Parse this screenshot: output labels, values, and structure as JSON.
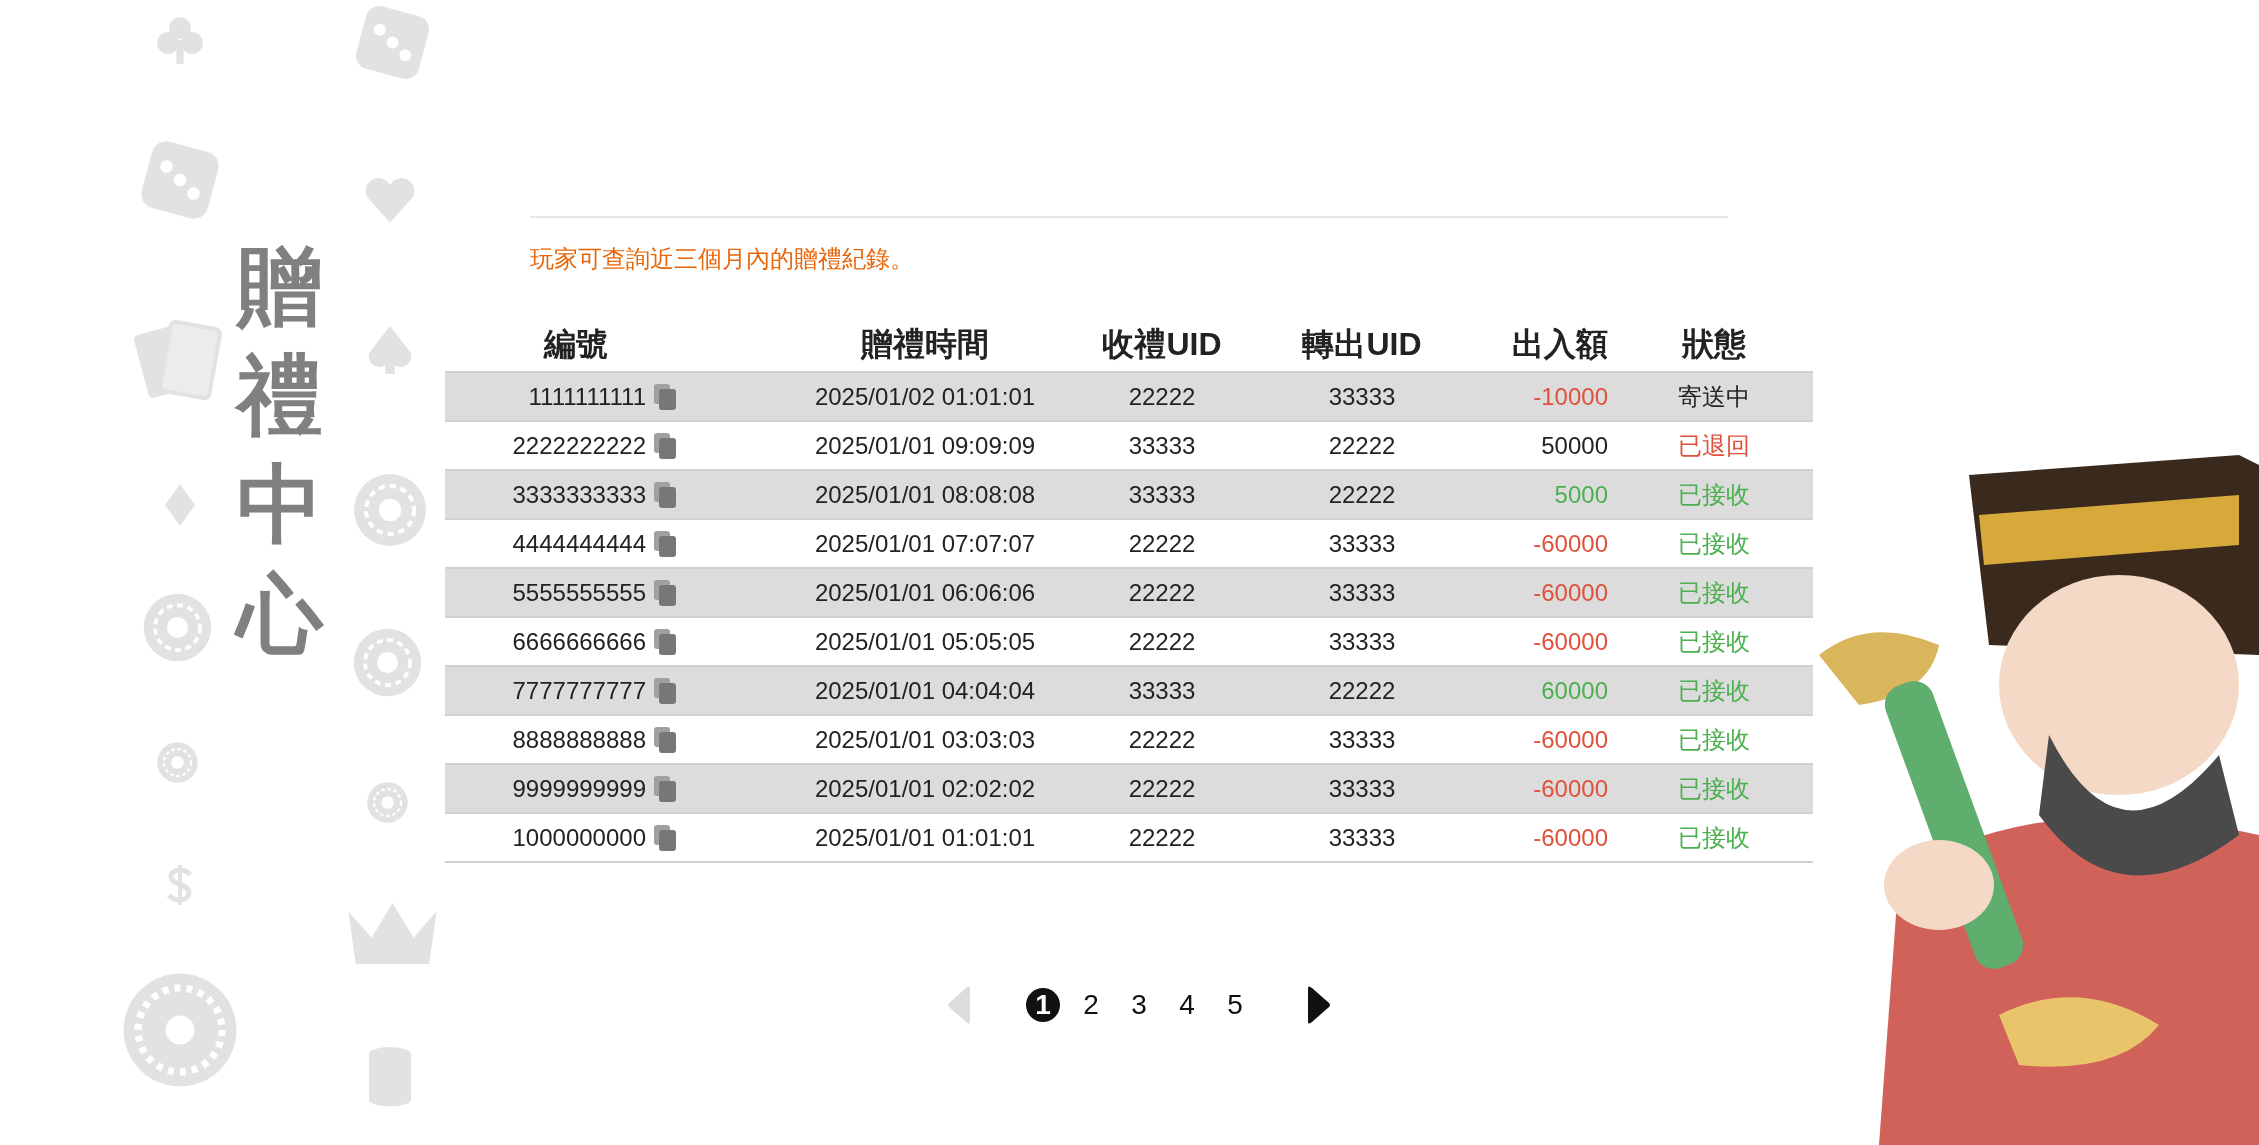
{
  "title": "贈禮中心",
  "note": "玩家可查詢近三個月內的贈禮紀錄。",
  "table": {
    "columns": [
      "編號",
      "贈禮時間",
      "收禮UID",
      "轉出UID",
      "出入額",
      "狀態"
    ],
    "rows": [
      {
        "id": "1111111111",
        "time": "2025/01/02 01:01:01",
        "to_uid": "22222",
        "from_uid": "33333",
        "amount": {
          "text": "-10000",
          "color": "#e0503a"
        },
        "status": {
          "text": "寄送中",
          "color": "#222222"
        }
      },
      {
        "id": "2222222222",
        "time": "2025/01/01 09:09:09",
        "to_uid": "33333",
        "from_uid": "22222",
        "amount": {
          "text": "50000",
          "color": "#222222"
        },
        "status": {
          "text": "已退回",
          "color": "#e0503a"
        }
      },
      {
        "id": "3333333333",
        "time": "2025/01/01 08:08:08",
        "to_uid": "33333",
        "from_uid": "22222",
        "amount": {
          "text": "5000",
          "color": "#4caf50"
        },
        "status": {
          "text": "已接收",
          "color": "#4caf50"
        }
      },
      {
        "id": "4444444444",
        "time": "2025/01/01 07:07:07",
        "to_uid": "22222",
        "from_uid": "33333",
        "amount": {
          "text": "-60000",
          "color": "#e0503a"
        },
        "status": {
          "text": "已接收",
          "color": "#4caf50"
        }
      },
      {
        "id": "5555555555",
        "time": "2025/01/01 06:06:06",
        "to_uid": "22222",
        "from_uid": "33333",
        "amount": {
          "text": "-60000",
          "color": "#e0503a"
        },
        "status": {
          "text": "已接收",
          "color": "#4caf50"
        }
      },
      {
        "id": "6666666666",
        "time": "2025/01/01 05:05:05",
        "to_uid": "22222",
        "from_uid": "33333",
        "amount": {
          "text": "-60000",
          "color": "#e0503a"
        },
        "status": {
          "text": "已接收",
          "color": "#4caf50"
        }
      },
      {
        "id": "7777777777",
        "time": "2025/01/01 04:04:04",
        "to_uid": "33333",
        "from_uid": "22222",
        "amount": {
          "text": "60000",
          "color": "#4caf50"
        },
        "status": {
          "text": "已接收",
          "color": "#4caf50"
        }
      },
      {
        "id": "8888888888",
        "time": "2025/01/01 03:03:03",
        "to_uid": "22222",
        "from_uid": "33333",
        "amount": {
          "text": "-60000",
          "color": "#e0503a"
        },
        "status": {
          "text": "已接收",
          "color": "#4caf50"
        }
      },
      {
        "id": "9999999999",
        "time": "2025/01/01 02:02:02",
        "to_uid": "22222",
        "from_uid": "33333",
        "amount": {
          "text": "-60000",
          "color": "#e0503a"
        },
        "status": {
          "text": "已接收",
          "color": "#4caf50"
        }
      },
      {
        "id": "1000000000",
        "time": "2025/01/01 01:01:01",
        "to_uid": "22222",
        "from_uid": "33333",
        "amount": {
          "text": "-60000",
          "color": "#e0503a"
        },
        "status": {
          "text": "已接收",
          "color": "#4caf50"
        }
      }
    ]
  },
  "pagination": {
    "prev_disabled": true,
    "next_disabled": false,
    "pages": [
      {
        "label": "1",
        "selected": true
      },
      {
        "label": "2",
        "selected": false
      },
      {
        "label": "3",
        "selected": false
      },
      {
        "label": "4",
        "selected": false
      },
      {
        "label": "5",
        "selected": false
      }
    ]
  }
}
